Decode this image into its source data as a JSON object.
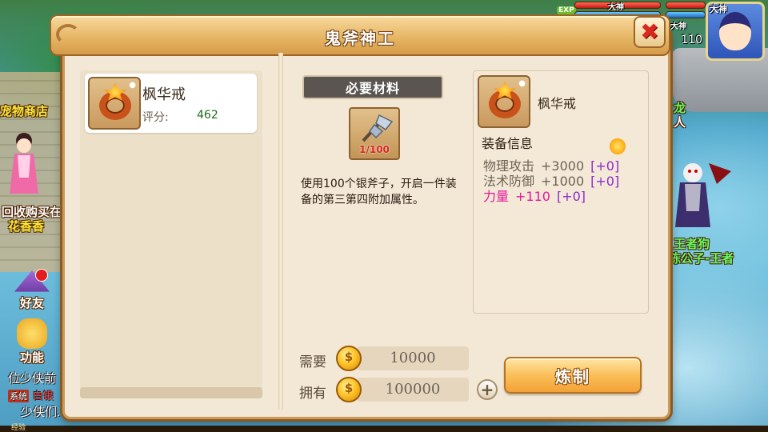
{
  "scene": {
    "shop_label": "宠物商店",
    "npc1_label": "回收购买在",
    "npc1_name": "花香香",
    "npc2_title_partial": "龙",
    "npc2_name_partial": "人",
    "npc3_title": "王者狗",
    "npc3_name": "陈公子-王者"
  },
  "side_buttons": {
    "friends_label": "好友",
    "functions_label": "功能"
  },
  "chat": {
    "line1": "位少侠前",
    "system_tag": "系统",
    "line2_text": "白银",
    "line3": "少侠们."
  },
  "hud": {
    "exp_badge": "EXP",
    "tag1": "大神",
    "tag2": "大神",
    "player_tag": "大神",
    "number": "110",
    "exp_label": "经验"
  },
  "dialog": {
    "title": "鬼斧神工",
    "close_symbol": "✖",
    "item_list": [
      {
        "name": "枫华戒",
        "score_label": "评分:",
        "score": "462"
      }
    ],
    "required_materials_label": "必要材料",
    "material": {
      "icon": "axe-icon",
      "count": "1/100"
    },
    "description": "使用100个银斧子，开启一件装备的第三第四附加属性。",
    "info": {
      "name": "枫华戒",
      "header": "装备信息",
      "stats": [
        {
          "label": "物理攻击",
          "value": "+3000",
          "bonus": "[+0]"
        },
        {
          "label": "法术防御",
          "value": "+1000",
          "bonus": "[+0]"
        },
        {
          "label": "力量",
          "value": "+110",
          "bonus": "[+0]"
        }
      ]
    },
    "cost": {
      "need_label": "需要",
      "need_value": "10000",
      "have_label": "拥有",
      "have_value": "100000",
      "plus_symbol": "+"
    },
    "forge_button": "炼制"
  },
  "colors": {
    "title_gold": "#e7b766",
    "stat_pink": "#e5189c",
    "bonus_purple": "#8a2ad0",
    "score_green": "#1d6b1d",
    "close_red": "#d9281c"
  }
}
